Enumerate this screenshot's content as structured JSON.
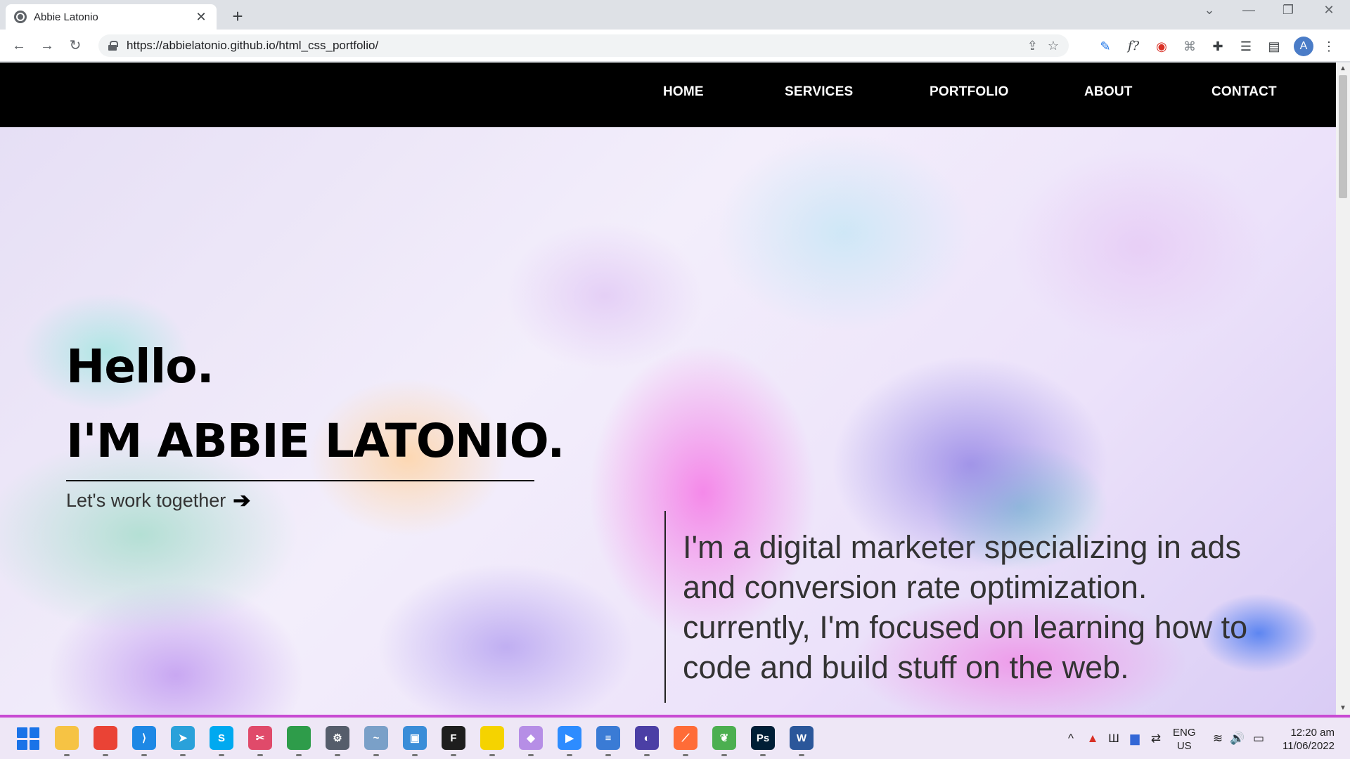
{
  "browser": {
    "tab_title": "Abbie Latonio",
    "tab_close": "✕",
    "new_tab": "+",
    "url": "https://abbielatonio.github.io/html_css_portfolio/",
    "window_controls": [
      "⌄",
      "—",
      "❐",
      "✕"
    ],
    "profile_initial": "A"
  },
  "site": {
    "nav": [
      "HOME",
      "SERVICES",
      "PORTFOLIO",
      "ABOUT",
      "CONTACT"
    ],
    "hero": {
      "greeting": "Hello.",
      "name": "I'M ABBIE LATONIO.",
      "cta": "Let's work together",
      "bio": "I'm a digital marketer specializing in ads and conversion rate optimization. currently, I'm focused on learning how to code and build stuff on the web."
    }
  },
  "taskbar": {
    "apps": [
      {
        "name": "file-explorer-icon",
        "color": "#f6c344",
        "glyph": ""
      },
      {
        "name": "chrome-icon",
        "color": "#ea4335",
        "glyph": ""
      },
      {
        "name": "vscode-icon",
        "color": "#1e88e5",
        "glyph": "⟩"
      },
      {
        "name": "telegram-icon",
        "color": "#2aa1da",
        "glyph": "➤"
      },
      {
        "name": "skype-icon",
        "color": "#00a9f0",
        "glyph": "S"
      },
      {
        "name": "snipping-tool-icon",
        "color": "#e04a6a",
        "glyph": "✂"
      },
      {
        "name": "photo-app-icon",
        "color": "#2e9c4a",
        "glyph": ""
      },
      {
        "name": "settings-icon",
        "color": "#555d6b",
        "glyph": "⚙"
      },
      {
        "name": "resource-monitor-icon",
        "color": "#7aa0c8",
        "glyph": "~"
      },
      {
        "name": "remote-desktop-icon",
        "color": "#3a8dd8",
        "glyph": "▣"
      },
      {
        "name": "figma-icon",
        "color": "#1e1e1e",
        "glyph": "F"
      },
      {
        "name": "sticky-notes-icon",
        "color": "#f5d300",
        "glyph": ""
      },
      {
        "name": "git-icon",
        "color": "#b68ee6",
        "glyph": "◆"
      },
      {
        "name": "zoom-icon",
        "color": "#2d8cff",
        "glyph": "▶"
      },
      {
        "name": "notepad-icon",
        "color": "#3a7bd5",
        "glyph": "≡"
      },
      {
        "name": "eclipse-icon",
        "color": "#4b3fa5",
        "glyph": "◐"
      },
      {
        "name": "postman-icon",
        "color": "#ff6c37",
        "glyph": "⟋"
      },
      {
        "name": "mongodb-icon",
        "color": "#4caf50",
        "glyph": "❦"
      },
      {
        "name": "photoshop-icon",
        "color": "#001e36",
        "glyph": "Ps"
      },
      {
        "name": "word-icon",
        "color": "#2b579a",
        "glyph": "W"
      }
    ],
    "tray": [
      "^",
      "▲",
      "Ш",
      "▆",
      "⇄",
      "≋",
      "🔊",
      "▭"
    ],
    "lang_top": "ENG",
    "lang_bottom": "US",
    "time": "12:20 am",
    "date": "11/06/2022"
  }
}
